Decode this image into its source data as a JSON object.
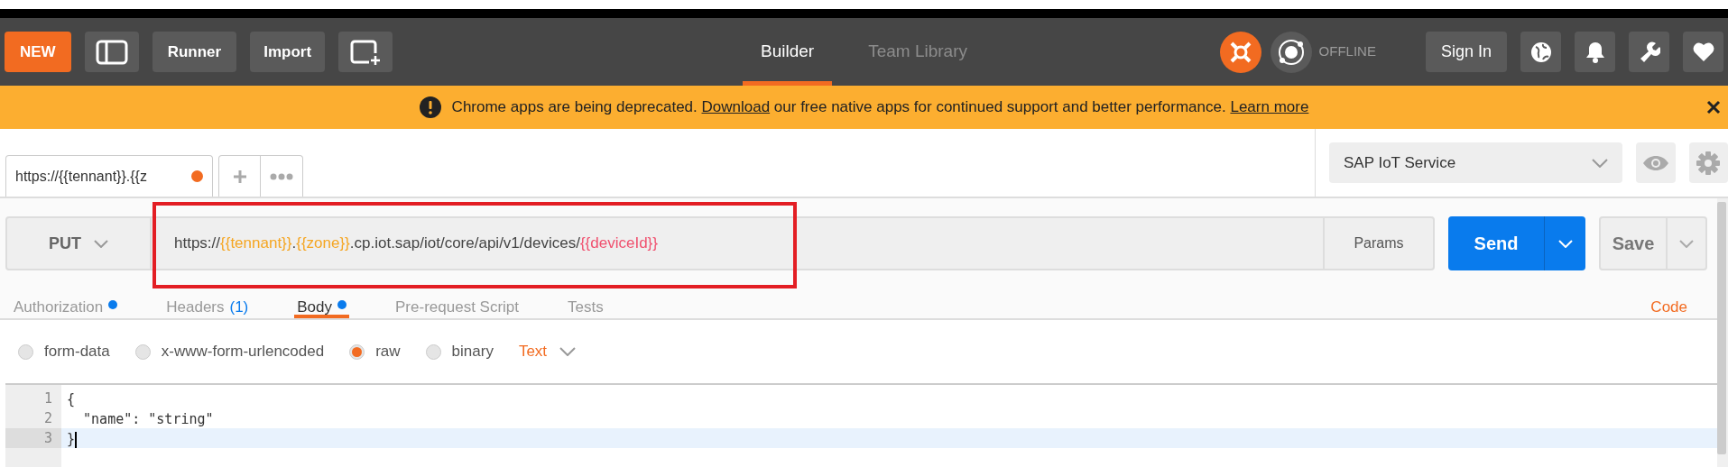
{
  "header": {
    "new_button": "NEW",
    "runner_button": "Runner",
    "import_button": "Import",
    "nav_tabs": [
      {
        "label": "Builder",
        "selected": true
      },
      {
        "label": "Team Library",
        "selected": false
      }
    ],
    "sync_status": "OFFLINE",
    "sign_in_button": "Sign In"
  },
  "banner": {
    "message": "Chrome apps are being deprecated.",
    "download_link": "Download",
    "message_end": "our free native apps for continued support and better performance.",
    "learn_more_link": "Learn more"
  },
  "request_tabs": [
    {
      "title": "https://{{tennant}}.{{z",
      "unsaved": true
    }
  ],
  "environment": {
    "selected": "SAP IoT Service"
  },
  "request": {
    "method": "PUT",
    "url_parts": [
      {
        "text": "https://",
        "kind": "plain"
      },
      {
        "text": "{{tennant}}",
        "kind": "variable"
      },
      {
        "text": ".",
        "kind": "plain"
      },
      {
        "text": "{{zone}}",
        "kind": "variable"
      },
      {
        "text": ".cp.iot.sap/iot/core/api/v1/devices/",
        "kind": "plain"
      },
      {
        "text": "{{deviceId}}",
        "kind": "unresolved"
      }
    ],
    "params_button": "Params",
    "send_button": "Send",
    "save_button": "Save"
  },
  "sections": [
    {
      "label": "Authorization",
      "selected": false,
      "indicator": true
    },
    {
      "label": "Headers",
      "count": "(1)",
      "selected": false,
      "indicator": false
    },
    {
      "label": "Body",
      "selected": true,
      "indicator": true
    },
    {
      "label": "Pre-request Script",
      "selected": false,
      "indicator": false
    },
    {
      "label": "Tests",
      "selected": false,
      "indicator": false
    }
  ],
  "code_link": "Code",
  "body_modes": [
    {
      "label": "form-data",
      "selected": false
    },
    {
      "label": "x-www-form-urlencoded",
      "selected": false
    },
    {
      "label": "raw",
      "selected": true
    },
    {
      "label": "binary",
      "selected": false
    }
  ],
  "body_format": "Text",
  "editor_lines": [
    {
      "number": "1",
      "text": "{",
      "active": false
    },
    {
      "number": "2",
      "text": "  \"name\": \"string\"",
      "active": false
    },
    {
      "number": "3",
      "text": "}",
      "active": true
    }
  ]
}
